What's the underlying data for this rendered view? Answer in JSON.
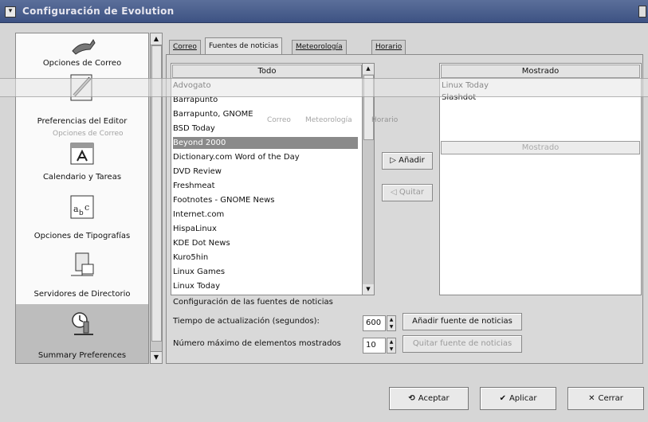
{
  "window": {
    "title": "Configuración de Evolution"
  },
  "sidebar": {
    "items": [
      {
        "label": "Opciones de Correo",
        "icon": "mail-options-icon"
      },
      {
        "label": "Preferencias del Editor",
        "icon": "editor-pencil-icon"
      },
      {
        "label": "Calendario y Tareas",
        "icon": "calendar-icon"
      },
      {
        "label": "Opciones de Tipografías",
        "icon": "font-icon"
      },
      {
        "label": "Servidores de Directorio",
        "icon": "directory-server-icon"
      },
      {
        "label": "Summary Preferences",
        "icon": "summary-clock-icon",
        "selected": true
      }
    ],
    "ghost_label": "Opciones de Correo"
  },
  "tabs": [
    {
      "label": "Correo"
    },
    {
      "label": "Fuentes de noticias",
      "active": true
    },
    {
      "label": "Meteorología"
    },
    {
      "label": "Horario"
    }
  ],
  "ghost_tabs": [
    "Correo",
    "Meteorología",
    "Horario"
  ],
  "all_list": {
    "header": "Todo",
    "items": [
      "Advogato",
      "Barrapunto",
      "Barrapunto, GNOME",
      "BSD Today",
      "Beyond 2000",
      "Dictionary.com Word of the Day",
      "DVD Review",
      "Freshmeat",
      "Footnotes - GNOME News",
      "Internet.com",
      "HispaLinux",
      "KDE Dot News",
      "Kuro5hin",
      "Linux Games",
      "Linux Today"
    ],
    "selected_index": 4
  },
  "shown_list": {
    "header": "Mostrado",
    "items": [
      "Linux Today",
      "Slashdot"
    ],
    "ghost_header": "Mostrado"
  },
  "buttons": {
    "add": "Añadir",
    "remove": "Quitar",
    "add_source": "Añadir fuente de noticias",
    "remove_source": "Quitar fuente de noticias",
    "ok": "Aceptar",
    "apply": "Aplicar",
    "close": "Cerrar"
  },
  "settings": {
    "section_title": "Configuración de las fuentes de noticias",
    "refresh_label": "Tiempo de actualización (segundos):",
    "refresh_value": "600",
    "max_items_label": "Número máximo de elementos mostrados",
    "max_items_value": "10"
  }
}
